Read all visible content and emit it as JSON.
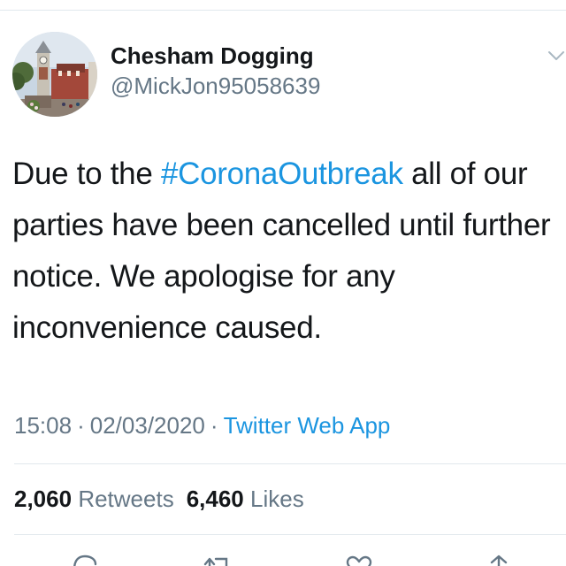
{
  "tweet": {
    "display_name": "Chesham Dogging",
    "handle": "@MickJon95058639",
    "text": {
      "part1": "Due to the ",
      "hashtag": "#CoronaOutbreak",
      "part2": " all of our parties have been cancelled until further notice. We apologise for any inconvenience caused."
    },
    "time": "15:08",
    "date": "02/03/2020",
    "separator": "·",
    "source": "Twitter Web App"
  },
  "stats": {
    "retweets_count": "2,060",
    "retweets_label": "Retweets",
    "likes_count": "6,460",
    "likes_label": "Likes"
  },
  "icons": {
    "caret": "chevron-down-icon",
    "reply": "reply-icon",
    "retweet": "retweet-icon",
    "like": "heart-icon",
    "share": "share-icon"
  },
  "colors": {
    "link": "#1b95e0",
    "secondary_text": "#657786",
    "primary_text": "#14171a",
    "divider": "#e1e8ed"
  }
}
